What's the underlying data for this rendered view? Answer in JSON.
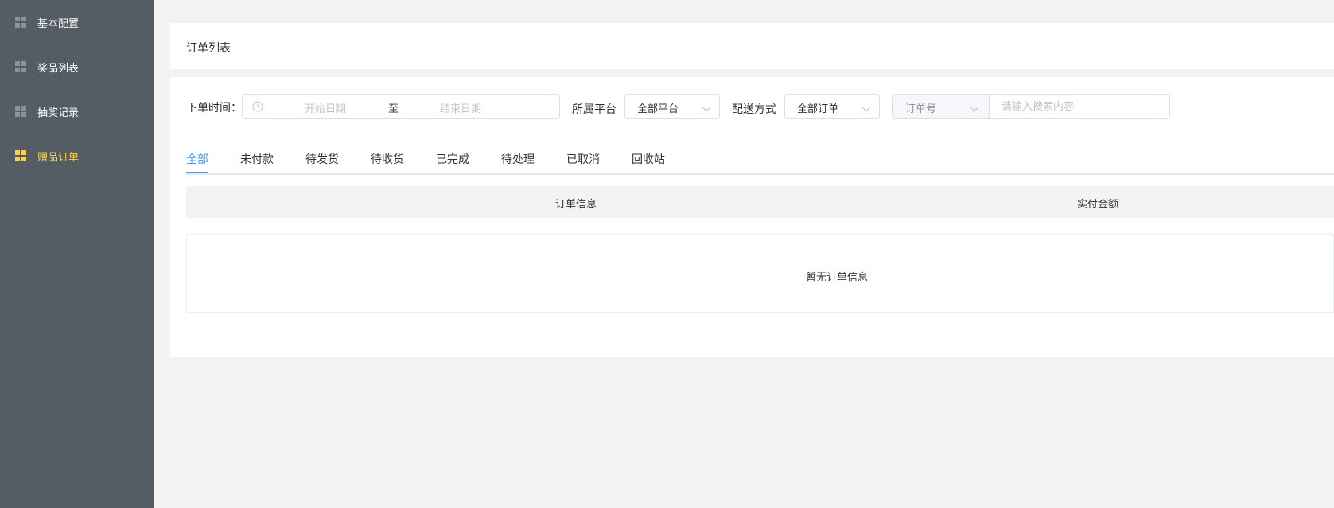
{
  "sidebar": {
    "items": [
      {
        "label": "基本配置",
        "icon": "grid-icon",
        "active": false
      },
      {
        "label": "奖品列表",
        "icon": "grid-icon",
        "active": false
      },
      {
        "label": "抽奖记录",
        "icon": "grid-icon",
        "active": false
      },
      {
        "label": "赠品订单",
        "icon": "grid-icon",
        "active": true
      }
    ],
    "bg_color": "#545c64",
    "active_color": "#ffd04b"
  },
  "header": {
    "title": "订单列表"
  },
  "filters": {
    "order_time_label": "下单时间：",
    "start_placeholder": "开始日期",
    "range_separator": "至",
    "end_placeholder": "结束日期",
    "platform_label": "所属平台",
    "platform_value": "全部平台",
    "delivery_label": "配送方式",
    "delivery_value": "全部订单",
    "search_type_value": "订单号",
    "search_placeholder": "请输入搜索内容"
  },
  "tabs": [
    "全部",
    "未付款",
    "待发货",
    "待收货",
    "已完成",
    "待处理",
    "已取消",
    "回收站"
  ],
  "active_tab": 0,
  "table": {
    "headers": [
      "订单信息",
      "实付金额"
    ],
    "empty_text": "暂无订单信息"
  },
  "accent_color": "#409eff"
}
